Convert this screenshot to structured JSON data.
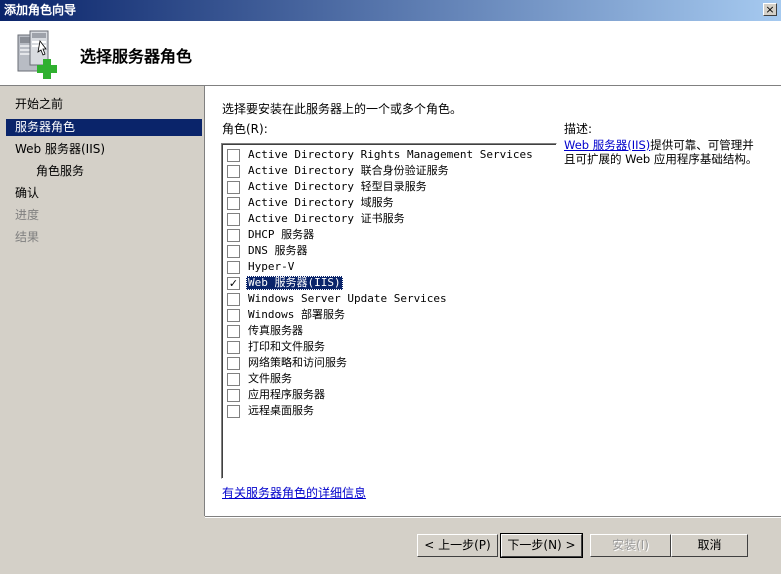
{
  "window": {
    "title": "添加角色向导",
    "close_label": "×"
  },
  "header": {
    "title": "选择服务器角色",
    "icon": "server-add-icon"
  },
  "nav": {
    "items": [
      {
        "label": "开始之前"
      },
      {
        "label": "服务器角色"
      },
      {
        "label": "Web 服务器(IIS)"
      },
      {
        "label": "角色服务"
      },
      {
        "label": "确认"
      },
      {
        "label": "进度"
      },
      {
        "label": "结果"
      }
    ],
    "active": "服务器角色"
  },
  "main": {
    "instruction": "选择要安装在此服务器上的一个或多个角色。",
    "roles_label": "角色(R):",
    "roles": [
      {
        "label": "Active Directory Rights Management Services",
        "checked": false
      },
      {
        "label": "Active Directory 联合身份验证服务",
        "checked": false
      },
      {
        "label": "Active Directory 轻型目录服务",
        "checked": false
      },
      {
        "label": "Active Directory 域服务",
        "checked": false
      },
      {
        "label": "Active Directory 证书服务",
        "checked": false
      },
      {
        "label": "DHCP 服务器",
        "checked": false
      },
      {
        "label": "DNS 服务器",
        "checked": false
      },
      {
        "label": "Hyper-V",
        "checked": false
      },
      {
        "label": "Web 服务器(IIS)",
        "checked": true,
        "selected": true
      },
      {
        "label": "Windows Server Update Services",
        "checked": false
      },
      {
        "label": "Windows 部署服务",
        "checked": false
      },
      {
        "label": "传真服务器",
        "checked": false
      },
      {
        "label": "打印和文件服务",
        "checked": false
      },
      {
        "label": "网络策略和访问服务",
        "checked": false
      },
      {
        "label": "文件服务",
        "checked": false
      },
      {
        "label": "应用程序服务器",
        "checked": false
      },
      {
        "label": "远程桌面服务",
        "checked": false
      }
    ],
    "check_mark": "✓",
    "description_label": "描述:",
    "description_link": "Web 服务器(IIS)",
    "description_text": "提供可靠、可管理并且可扩展的 Web 应用程序基础结构。",
    "more_info_link": "有关服务器角色的详细信息"
  },
  "buttons": {
    "back": "< 上一步(P)",
    "next": "下一步(N) >",
    "install": "安装(I)",
    "cancel": "取消"
  }
}
